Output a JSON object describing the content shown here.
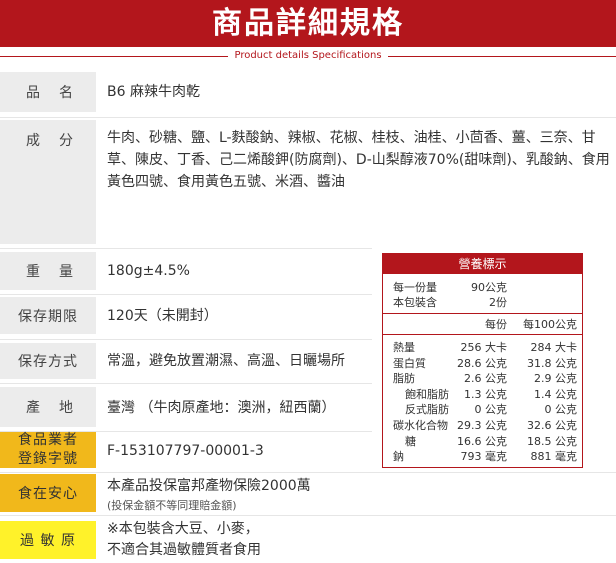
{
  "header": {
    "title": "商品詳細規格",
    "subtitle": "Product details Specifications"
  },
  "specs": {
    "name_label": [
      "品",
      "名"
    ],
    "name_value": "B6 麻辣牛肉乾",
    "ingredients_label": [
      "成",
      "分"
    ],
    "ingredients_lines": [
      "牛肉、砂糖、鹽、L-麩酸鈉、辣椒、花椒、桂枝、油桂、小茴香、薑、三奈、甘",
      "草、陳皮、丁香、己二烯酸鉀(防腐劑)、D-山梨醇液70%(甜味劑)、乳酸鈉、食用",
      "黃色四號、食用黃色五號、米酒、醬油"
    ],
    "weight_label": [
      "重",
      "量"
    ],
    "weight_value": "180g±4.5%",
    "shelf_label": "保存期限",
    "shelf_value": "120天（未開封）",
    "storage_label": "保存方式",
    "storage_value": "常溫，避免放置潮濕、高溫、日曬場所",
    "origin_label": [
      "產",
      "地"
    ],
    "origin_value": "臺灣 （牛肉原產地：澳洲，紐西蘭）",
    "registration_label": [
      "食品業者",
      "登錄字號"
    ],
    "registration_value": "F-153107797-00001-3",
    "insurance_label": "食在安心",
    "insurance_value": "本產品投保富邦產物保險2000萬",
    "insurance_note": "(投保金額不等同理賠金額)",
    "allergen_label": "過 敏 原",
    "allergen_lines": [
      "※本包裝含大豆、小麥，",
      "不適合其過敏體質者食用"
    ]
  },
  "nutrition": {
    "title": "營養標示",
    "serving_size_label": "每一份量",
    "serving_size_value": "90公克",
    "servings_label": "本包裝含",
    "servings_value": "2份",
    "col_per_serving": "每份",
    "col_per_100": "每100公克",
    "rows": [
      {
        "name": "熱量",
        "per_serving": "256 大卡",
        "per_100": "284 大卡",
        "indent": false
      },
      {
        "name": "蛋白質",
        "per_serving": "28.6 公克",
        "per_100": "31.8 公克",
        "indent": false
      },
      {
        "name": "脂肪",
        "per_serving": "2.6 公克",
        "per_100": "2.9 公克",
        "indent": false
      },
      {
        "name": "飽和脂肪",
        "per_serving": "1.3 公克",
        "per_100": "1.4 公克",
        "indent": true
      },
      {
        "name": "反式脂肪",
        "per_serving": "0 公克",
        "per_100": "0 公克",
        "indent": true
      },
      {
        "name": "碳水化合物",
        "per_serving": "29.3 公克",
        "per_100": "32.6 公克",
        "indent": false
      },
      {
        "name": "糖",
        "per_serving": "16.6 公克",
        "per_100": "18.5 公克",
        "indent": true
      },
      {
        "name": "鈉",
        "per_serving": "793 毫克",
        "per_100": "881 毫克",
        "indent": false
      }
    ]
  }
}
